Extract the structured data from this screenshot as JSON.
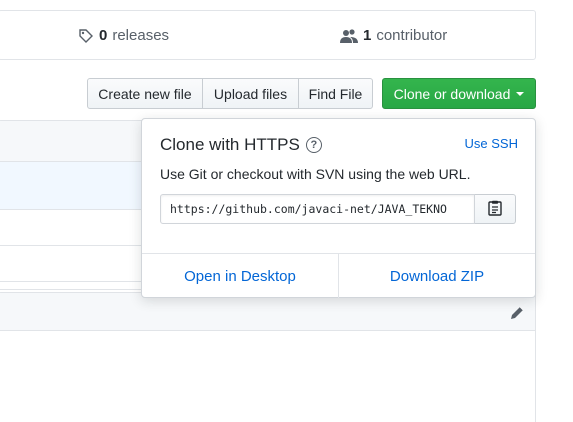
{
  "summary": {
    "releases_count": "0",
    "releases_label": "releases",
    "contributors_count": "1",
    "contributors_label": "contributor"
  },
  "toolbar": {
    "create_label": "Create new file",
    "upload_label": "Upload files",
    "find_label": "Find File",
    "clone_label": "Clone or download"
  },
  "clone_popover": {
    "title": "Clone with HTTPS",
    "help_glyph": "?",
    "use_ssh_label": "Use SSH",
    "description": "Use Git or checkout with SVN using the web URL.",
    "url_value": "https://github.com/javaci-net/JAVA_TEKNO",
    "open_desktop_label": "Open in Desktop",
    "download_zip_label": "Download ZIP"
  },
  "icons": {
    "releases": "tag-icon",
    "contributors": "people-icon",
    "copy": "clipboard-icon",
    "help": "question-icon",
    "edit": "pencil-icon",
    "dropdown": "caret-down-icon"
  },
  "colors": {
    "primary_green": "#28a745",
    "link_blue": "#0366d6",
    "text": "#24292e",
    "muted": "#586069"
  }
}
